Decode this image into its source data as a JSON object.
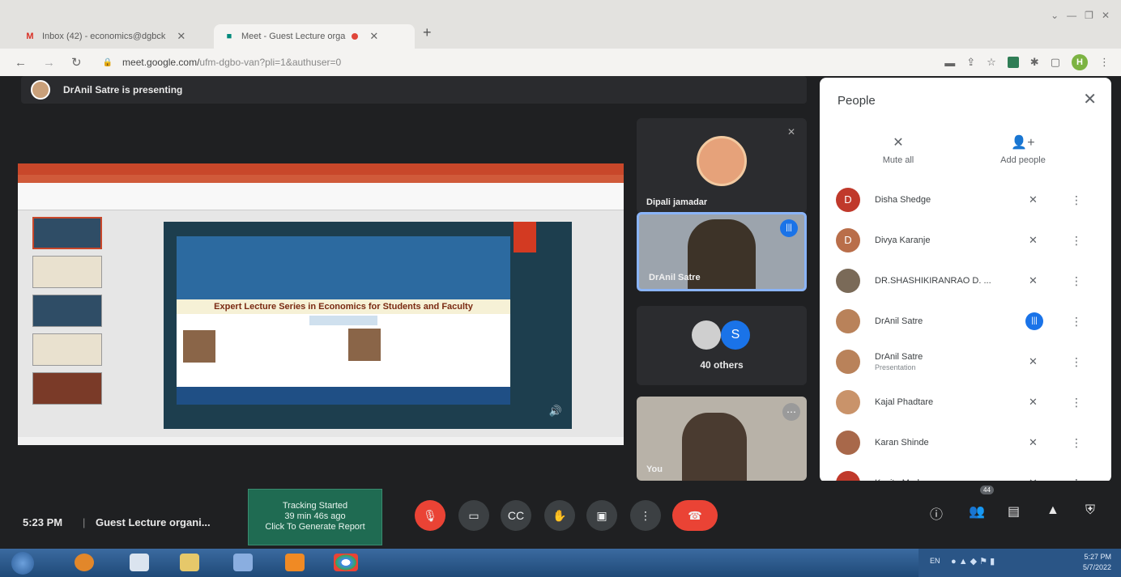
{
  "browser": {
    "tabs": [
      {
        "label": "Inbox (42) - economics@dgbck",
        "favicon": "M"
      },
      {
        "label": "Meet - Guest Lecture orga",
        "favicon": "camera"
      }
    ],
    "url": "meet.google.com/",
    "url_path": "ufm-dgbo-van?pli=1&authuser=0",
    "profile_initial": "H"
  },
  "meet": {
    "presenting_text": "DrAnil Satre is presenting",
    "slide": {
      "poster_heading": "Expert Lecture Series in Economics for Students and Faculty"
    },
    "tiles": {
      "tile1_name": "Dipali jamadar",
      "tile2_name": "DrAnil Satre",
      "tile3_avatar_letter": "S",
      "tile3_others": "40 others",
      "tile4_name": "You"
    },
    "people": {
      "title": "People",
      "mute_all": "Mute all",
      "add_people": "Add people",
      "participants": [
        {
          "name": "Disha Shedge",
          "initial": "D",
          "color": "#c0392b",
          "sub": "",
          "speaking": false
        },
        {
          "name": "Divya Karanje",
          "initial": "D",
          "color": "#b96e4a",
          "sub": "",
          "speaking": false
        },
        {
          "name": "DR.SHASHIKIRANRAO D. ...",
          "initial": "",
          "color": "#7a6a58",
          "sub": "",
          "speaking": false
        },
        {
          "name": "DrAnil Satre",
          "initial": "",
          "color": "#b9825a",
          "sub": "",
          "speaking": true
        },
        {
          "name": "DrAnil Satre",
          "initial": "",
          "color": "#b9825a",
          "sub": "Presentation",
          "speaking": false
        },
        {
          "name": "Kajal Phadtare",
          "initial": "",
          "color": "#c9936a",
          "sub": "",
          "speaking": false
        },
        {
          "name": "Karan Shinde",
          "initial": "",
          "color": "#a8684a",
          "sub": "",
          "speaking": false
        },
        {
          "name": "Kavita Madane",
          "initial": "",
          "color": "#c0392b",
          "sub": "",
          "speaking": false
        }
      ]
    },
    "bottom": {
      "time": "5:23 PM",
      "separator": "|",
      "meeting_title": "Guest Lecture organi...",
      "tracking_line1": "Tracking Started",
      "tracking_line2": "39 min 46s ago",
      "tracking_line3": "Click To Generate Report",
      "people_count": "44"
    },
    "taskbar": {
      "clock_time": "5:27 PM",
      "clock_date": "5/7/2022",
      "lang": "EN"
    }
  }
}
